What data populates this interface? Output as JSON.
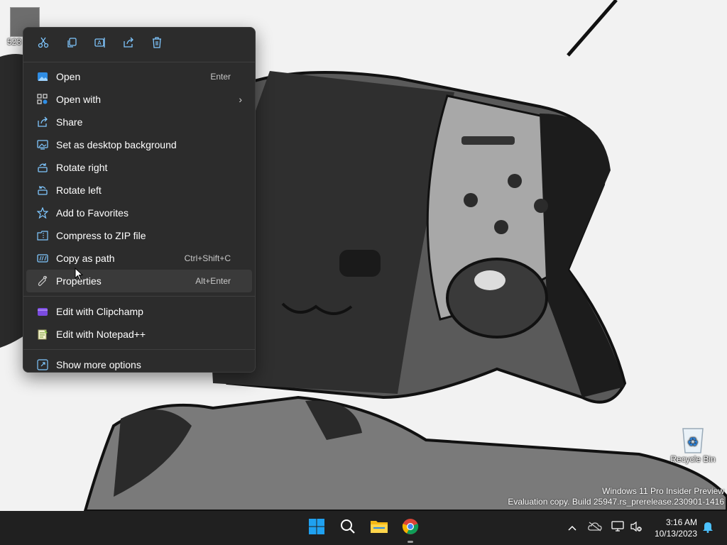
{
  "desktop": {
    "file_icon_label": "523",
    "recycle_bin_label": "Recycle Bin",
    "watermark_line1": "Windows 11 Pro Insider Preview",
    "watermark_line2": "Evaluation copy. Build 25947.rs_prerelease.230901-1416"
  },
  "context_menu": {
    "quick_actions": [
      {
        "name": "cut-icon"
      },
      {
        "name": "copy-icon"
      },
      {
        "name": "rename-icon"
      },
      {
        "name": "share-icon"
      },
      {
        "name": "delete-icon"
      }
    ],
    "items": [
      {
        "label": "Open",
        "accelerator": "Enter",
        "icon": "photos-icon"
      },
      {
        "label": "Open with",
        "accelerator": "",
        "icon": "open-with-icon",
        "submenu": true
      },
      {
        "label": "Share",
        "accelerator": "",
        "icon": "share-icon"
      },
      {
        "label": "Set as desktop background",
        "accelerator": "",
        "icon": "desktop-background-icon"
      },
      {
        "label": "Rotate right",
        "accelerator": "",
        "icon": "rotate-right-icon"
      },
      {
        "label": "Rotate left",
        "accelerator": "",
        "icon": "rotate-left-icon"
      },
      {
        "label": "Add to Favorites",
        "accelerator": "",
        "icon": "star-icon"
      },
      {
        "label": "Compress to ZIP file",
        "accelerator": "",
        "icon": "zip-icon"
      },
      {
        "label": "Copy as path",
        "accelerator": "Ctrl+Shift+C",
        "icon": "copy-path-icon"
      },
      {
        "label": "Properties",
        "accelerator": "Alt+Enter",
        "icon": "wrench-icon"
      }
    ],
    "extra_items": [
      {
        "label": "Edit with Clipchamp",
        "icon": "clipchamp-icon"
      },
      {
        "label": "Edit with Notepad++",
        "icon": "notepadpp-icon"
      }
    ],
    "more_options": {
      "label": "Show more options",
      "icon": "more-options-icon"
    }
  },
  "taskbar": {
    "time": "3:16 AM",
    "date": "10/13/2023"
  },
  "colors": {
    "menu_bg": "#2c2c2c",
    "taskbar_bg": "#202020",
    "accent": "#4cc2ff"
  }
}
